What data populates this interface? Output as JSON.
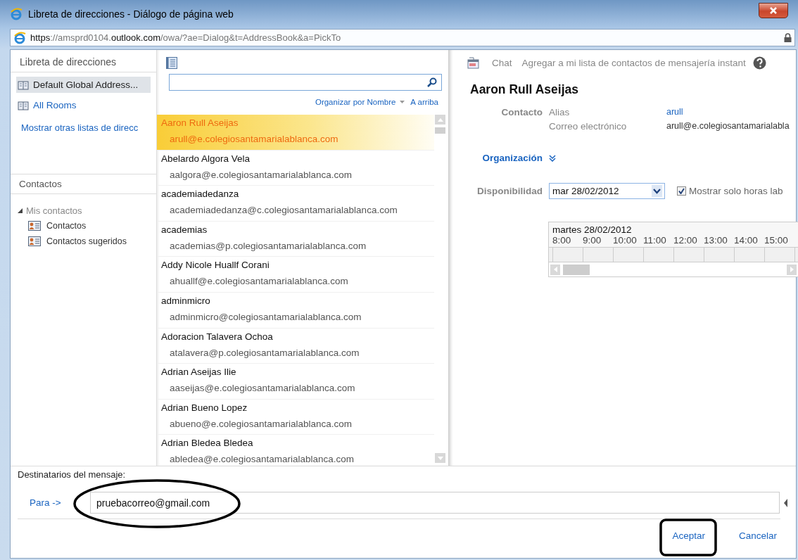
{
  "window": {
    "title": "Libreta de direcciones - Diálogo de página web",
    "url": "**https**://amsprd0104.**outlook.com**/owa/?ae=Dialog&t=AddressBook&a=PickTo"
  },
  "sidebar": {
    "heading": "Libreta de direcciones",
    "books": [
      {
        "label": "Default Global Address...",
        "selected": true
      },
      {
        "label": "All Rooms",
        "selected": false
      }
    ],
    "more_link": "Mostrar otras listas de direcc",
    "contacts_heading": "Contactos",
    "tree": [
      {
        "label": "Mis contactos",
        "expanded": true,
        "children": [
          {
            "label": "Contactos"
          },
          {
            "label": "Contactos sugeridos"
          }
        ]
      }
    ]
  },
  "list": {
    "sort_label": "Organizar por Nombre",
    "sort_order": "A arriba",
    "contacts": [
      {
        "name": "Aaron Rull Aseijas",
        "email": "arull@e.colegiosantamarialablanca.com",
        "selected": true
      },
      {
        "name": "Abelardo Algora Vela",
        "email": "aalgora@e.colegiosantamarialablanca.com",
        "selected": false
      },
      {
        "name": "academiadedanza",
        "email": "academiadedanza@c.colegiosantamarialablanca.com",
        "selected": false
      },
      {
        "name": "academias",
        "email": "academias@p.colegiosantamarialablanca.com",
        "selected": false
      },
      {
        "name": "Addy Nicole Huallf Corani",
        "email": "ahuallf@e.colegiosantamarialablanca.com",
        "selected": false
      },
      {
        "name": "adminmicro",
        "email": "adminmicro@colegiosantamarialablanca.com",
        "selected": false
      },
      {
        "name": "Adoracion Talavera Ochoa",
        "email": "atalavera@p.colegiosantamarialablanca.com",
        "selected": false
      },
      {
        "name": "Adrian Aseijas Ilie",
        "email": "aaseijas@e.colegiosantamarialablanca.com",
        "selected": false
      },
      {
        "name": "Adrian Bueno Lopez",
        "email": "abueno@e.colegiosantamarialablanca.com",
        "selected": false
      },
      {
        "name": "Adrian Bledea Bledea",
        "email": "abledea@e.colegiosantamarialablanca.com",
        "selected": false
      }
    ]
  },
  "details": {
    "toolbar": [
      "Chat",
      "Agregar a mi lista de contactos de mensajería instant"
    ],
    "name": "Aaron Rull Aseijas",
    "section_label": "Contacto",
    "fields": [
      {
        "label": "Alias",
        "value": "arull",
        "kind": "link"
      },
      {
        "label": "Correo electrónico",
        "value": "arull@e.colegiosantamarialabla",
        "kind": "text"
      }
    ],
    "organization": {
      "label": "Organización",
      "expanded": false
    },
    "availability": {
      "label": "Disponibilidad",
      "date": "mar 28/02/2012",
      "work_hours_only": {
        "label": "Mostrar solo horas lab",
        "checked": true
      },
      "day": "martes 28/02/2012",
      "hours": [
        "8:00",
        "9:00",
        "10:00",
        "11:00",
        "12:00",
        "13:00",
        "14:00",
        "15:00"
      ]
    }
  },
  "recipients": {
    "heading": "Destinatarios del mensaje:",
    "to_label": "Para ->",
    "to_value": "pruebacorreo@gmail.com"
  },
  "buttons": [
    {
      "label": "Aceptar"
    },
    {
      "label": "Cancelar"
    }
  ]
}
